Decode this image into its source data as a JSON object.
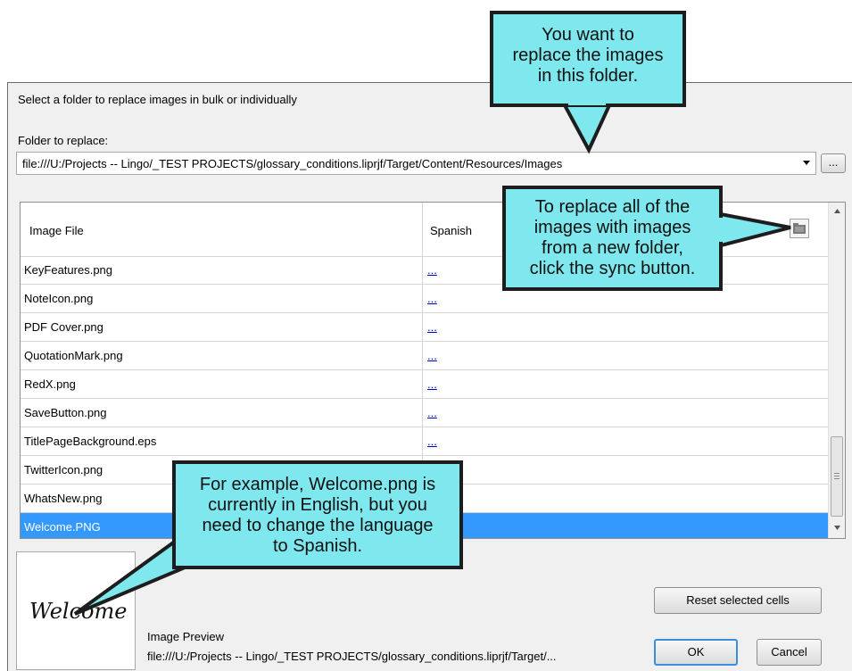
{
  "dialog": {
    "instruction": "Select a folder to replace images in bulk or individually",
    "folder_label": "Folder to replace:",
    "folder_value": "file:///U:/Projects -- Lingo/_TEST PROJECTS/glossary_conditions.liprjf/Target/Content/Resources/Images",
    "browse_label": "..."
  },
  "grid": {
    "columns": [
      "Image File",
      "Spanish"
    ],
    "rows": [
      {
        "file": "KeyFeatures.png",
        "spanish": "..."
      },
      {
        "file": "NoteIcon.png",
        "spanish": "..."
      },
      {
        "file": "PDF Cover.png",
        "spanish": "..."
      },
      {
        "file": "QuotationMark.png",
        "spanish": "..."
      },
      {
        "file": "RedX.png",
        "spanish": "..."
      },
      {
        "file": "SaveButton.png",
        "spanish": "..."
      },
      {
        "file": "TitlePageBackground.eps",
        "spanish": "..."
      },
      {
        "file": "TwitterIcon.png",
        "spanish": ""
      },
      {
        "file": "WhatsNew.png",
        "spanish": ""
      },
      {
        "file": "Welcome.PNG",
        "spanish": ""
      }
    ]
  },
  "preview": {
    "image_text": "Welcome",
    "label": "Image Preview",
    "path": "file:///U:/Projects -- Lingo/_TEST PROJECTS/glossary_conditions.liprjf/Target/..."
  },
  "buttons": {
    "reset": "Reset selected cells",
    "ok": "OK",
    "cancel": "Cancel"
  },
  "callouts": {
    "top": [
      "You want to",
      "replace the images",
      "in this folder."
    ],
    "right": [
      "To replace all of the",
      "images with images",
      "from a new folder,",
      "click the sync button."
    ],
    "bottom": [
      "For example, Welcome.png is",
      "currently in English, but you",
      "need to change the language",
      "to Spanish."
    ]
  },
  "colors": {
    "callout_fill": "#7ee8ee",
    "selection": "#3399ff",
    "link": "#0000cc"
  }
}
